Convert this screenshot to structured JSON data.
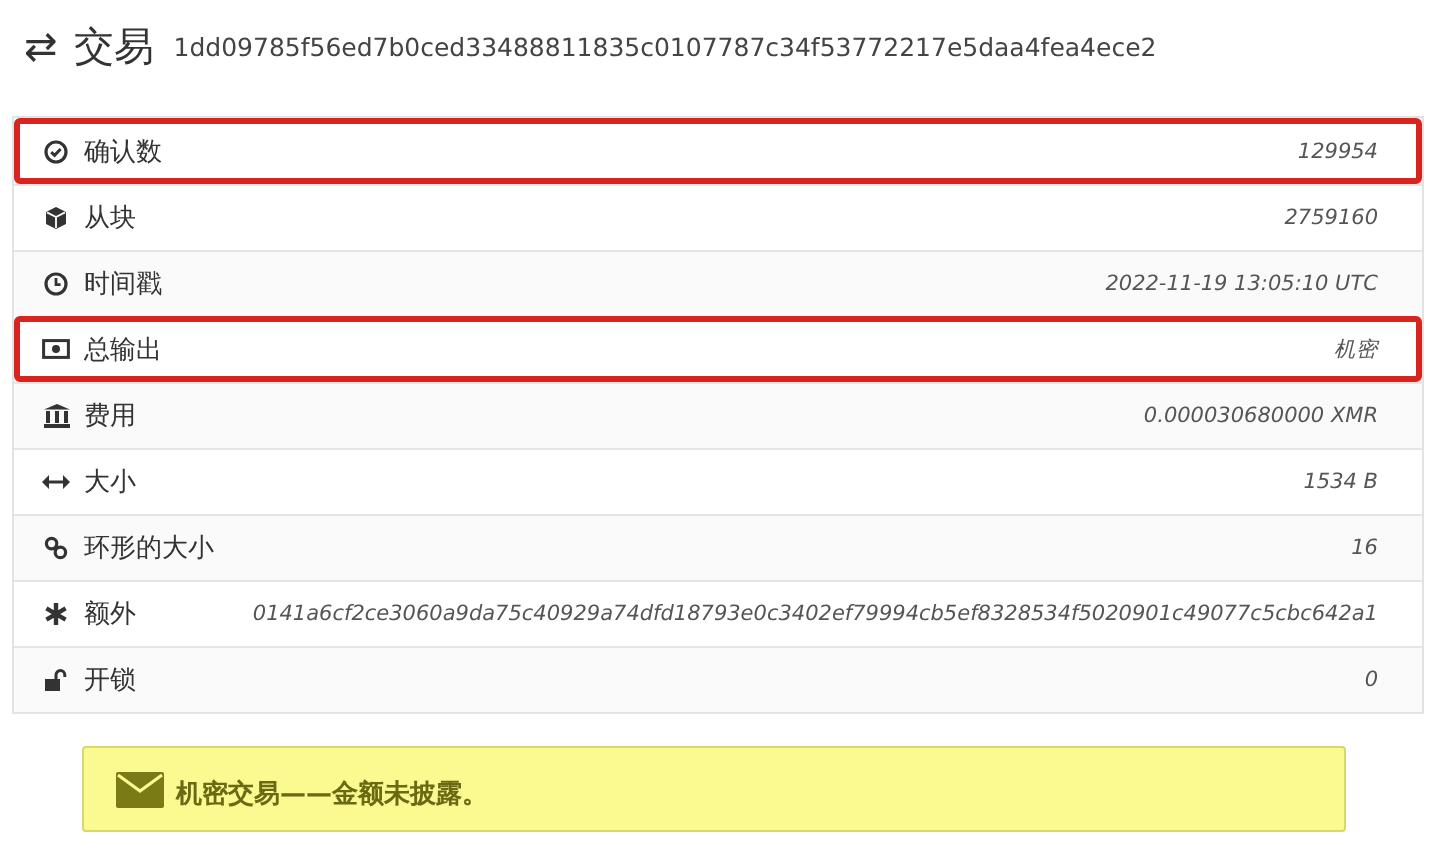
{
  "header": {
    "icon": "⇄",
    "title": "交易",
    "hash": "1dd09785f56ed7b0ced33488811835c0107787c34f53772217e5daa4fea4ece2"
  },
  "rows": [
    {
      "label": "确认数",
      "value": "129954",
      "highlighted": true
    },
    {
      "label": "从块",
      "value": "2759160",
      "highlighted": false
    },
    {
      "label": "时间戳",
      "value": "2022-11-19 13:05:10 UTC",
      "highlighted": false
    },
    {
      "label": "总输出",
      "value": "机密",
      "highlighted": true
    },
    {
      "label": "费用",
      "value": "0.000030680000 XMR",
      "highlighted": false
    },
    {
      "label": "大小",
      "value": "1534 B",
      "highlighted": false
    },
    {
      "label": "环形的大小",
      "value": "16",
      "highlighted": false
    },
    {
      "label": "额外",
      "value": "0141a6cf2ce3060a9da75c40929a74dfd18793e0c3402ef79994cb5ef8328534f5020901c49077c5cbc642a1",
      "highlighted": false
    },
    {
      "label": "开锁",
      "value": "0",
      "highlighted": false
    }
  ],
  "notice": {
    "text": "机密交易——金额未披露。"
  }
}
